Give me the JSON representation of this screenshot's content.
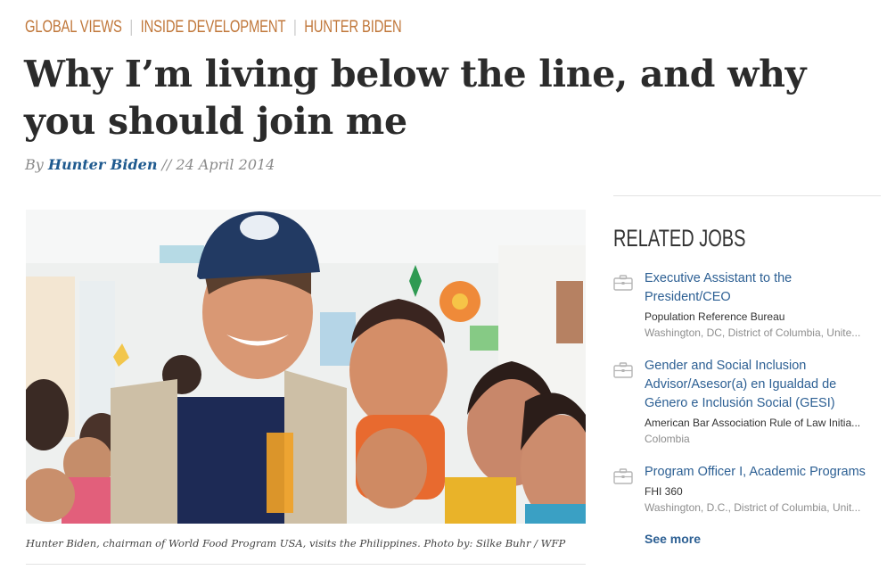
{
  "breadcrumbs": [
    "GLOBAL VIEWS",
    "INSIDE DEVELOPMENT",
    "HUNTER BIDEN"
  ],
  "article": {
    "title": "Why I’m living below the line, and why you should join me",
    "byline_prefix": "By",
    "author": "Hunter Biden",
    "date_separator": "//",
    "date": "24 April 2014",
    "photo_cap_text": "WFP",
    "caption": "Hunter Biden, chairman of World Food Program USA, visits the Philippines. Photo by: Silke Buhr / WFP"
  },
  "sidebar": {
    "title": "RELATED JOBS",
    "jobs": [
      {
        "title": "Executive Assistant to the President/CEO",
        "org": "Population Reference Bureau",
        "location": "Washington, DC, District of Columbia, Unite..."
      },
      {
        "title": "Gender and Social Inclusion Advisor/Asesor(a) en Igualdad de Género e Inclusión Social (GESI)",
        "org": "American Bar Association Rule of Law Initia...",
        "location": "Colombia"
      },
      {
        "title": "Program Officer I, Academic Programs",
        "org": "FHI 360",
        "location": "Washington, D.C., District of Columbia, Unit..."
      }
    ],
    "see_more": "See more"
  },
  "colors": {
    "breadcrumb": "#c0773a",
    "title": "#2b2b2b",
    "link": "#2c5f93",
    "muted": "#8e8e8e"
  },
  "icons": {
    "job_icon": "briefcase-icon"
  }
}
